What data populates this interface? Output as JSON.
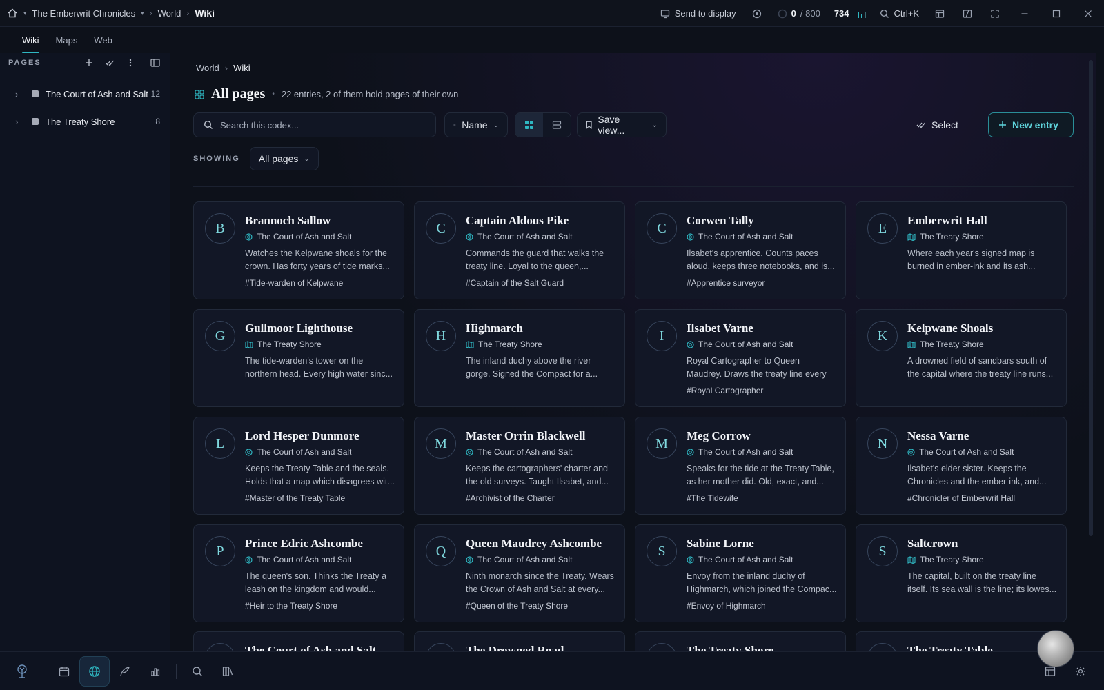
{
  "titlebar": {
    "project": "The Emberwrit Chronicles",
    "crumb_world": "World",
    "crumb_wiki": "Wiki",
    "send_to_display": "Send to display",
    "counter": "0",
    "counter_max": "/ 800",
    "word_count": "734",
    "shortcut": "Ctrl+K"
  },
  "tabs": [
    "Wiki",
    "Maps",
    "Web"
  ],
  "sidebar": {
    "label": "PAGES",
    "items": [
      {
        "name": "The Court of Ash and Salt",
        "count": "12"
      },
      {
        "name": "The Treaty Shore",
        "count": "8"
      }
    ]
  },
  "main": {
    "breadcrumb": [
      "World",
      "Wiki"
    ],
    "title": "All pages",
    "subtitle": "22 entries, 2 of them hold pages of their own",
    "search_placeholder": "Search this codex...",
    "sort_label": "Name",
    "save_view_label": "Save view...",
    "select_label": "Select",
    "new_entry_label": "New entry",
    "showing_label": "SHOWING",
    "showing_value": "All pages"
  },
  "cards": [
    {
      "letter": "B",
      "title": "Brannoch Sallow",
      "category": "The Court of Ash and Salt",
      "kind": "org",
      "desc": "Watches the Kelpwane shoals for the crown. Has forty years of tide marks...",
      "tag": "#Tide-warden of Kelpwane"
    },
    {
      "letter": "C",
      "title": "Captain Aldous Pike",
      "category": "The Court of Ash and Salt",
      "kind": "org",
      "desc": "Commands the guard that walks the treaty line. Loyal to the queen,...",
      "tag": "#Captain of the Salt Guard"
    },
    {
      "letter": "C",
      "title": "Corwen Tally",
      "category": "The Court of Ash and Salt",
      "kind": "org",
      "desc": "Ilsabet's apprentice. Counts paces aloud, keeps three notebooks, and is...",
      "tag": "#Apprentice surveyor"
    },
    {
      "letter": "E",
      "title": "Emberwrit Hall",
      "category": "The Treaty Shore",
      "kind": "map",
      "desc": "Where each year's signed map is burned in ember-ink and its ash...",
      "tag": ""
    },
    {
      "letter": "G",
      "title": "Gullmoor Lighthouse",
      "category": "The Treaty Shore",
      "kind": "map",
      "desc": "The tide-warden's tower on the northern head. Every high water sinc...",
      "tag": ""
    },
    {
      "letter": "H",
      "title": "Highmarch",
      "category": "The Treaty Shore",
      "kind": "map",
      "desc": "The inland duchy above the river gorge. Signed the Compact for a...",
      "tag": ""
    },
    {
      "letter": "I",
      "title": "Ilsabet Varne",
      "category": "The Court of Ash and Salt",
      "kind": "org",
      "desc": "Royal Cartographer to Queen Maudrey. Draws the treaty line every spring an...",
      "tag": "#Royal Cartographer"
    },
    {
      "letter": "K",
      "title": "Kelpwane Shoals",
      "category": "The Treaty Shore",
      "kind": "map",
      "desc": "A drowned field of sandbars south of the capital where the treaty line runs...",
      "tag": ""
    },
    {
      "letter": "L",
      "title": "Lord Hesper Dunmore",
      "category": "The Court of Ash and Salt",
      "kind": "org",
      "desc": "Keeps the Treaty Table and the seals. Holds that a map which disagrees wit...",
      "tag": "#Master of the Treaty Table"
    },
    {
      "letter": "M",
      "title": "Master Orrin Blackwell",
      "category": "The Court of Ash and Salt",
      "kind": "org",
      "desc": "Keeps the cartographers' charter and the old surveys. Taught Ilsabet, and...",
      "tag": "#Archivist of the Charter"
    },
    {
      "letter": "M",
      "title": "Meg Corrow",
      "category": "The Court of Ash and Salt",
      "kind": "org",
      "desc": "Speaks for the tide at the Treaty Table, as her mother did. Old, exact, and...",
      "tag": "#The Tidewife"
    },
    {
      "letter": "N",
      "title": "Nessa Varne",
      "category": "The Court of Ash and Salt",
      "kind": "org",
      "desc": "Ilsabet's elder sister. Keeps the Chronicles and the ember-ink, and...",
      "tag": "#Chronicler of Emberwrit Hall"
    },
    {
      "letter": "P",
      "title": "Prince Edric Ashcombe",
      "category": "The Court of Ash and Salt",
      "kind": "org",
      "desc": "The queen's son. Thinks the Treaty a leash on the kingdom and would...",
      "tag": "#Heir to the Treaty Shore"
    },
    {
      "letter": "Q",
      "title": "Queen Maudrey Ashcombe",
      "category": "The Court of Ash and Salt",
      "kind": "org",
      "desc": "Ninth monarch since the Treaty. Wears the Crown of Ash and Salt at every...",
      "tag": "#Queen of the Treaty Shore"
    },
    {
      "letter": "S",
      "title": "Sabine Lorne",
      "category": "The Court of Ash and Salt",
      "kind": "org",
      "desc": "Envoy from the inland duchy of Highmarch, which joined the Compac...",
      "tag": "#Envoy of Highmarch"
    },
    {
      "letter": "S",
      "title": "Saltcrown",
      "category": "The Treaty Shore",
      "kind": "map",
      "desc": "The capital, built on the treaty line itself. Its sea wall is the line; its lowes...",
      "tag": ""
    }
  ],
  "partial_cards": [
    {
      "title": "The Court of Ash and Salt"
    },
    {
      "title": "The Drowned Road"
    },
    {
      "title": "The Treaty Shore"
    },
    {
      "title": "The Treaty Table"
    }
  ],
  "colors": {
    "accent": "#2fb7c2",
    "background": "#0d111a",
    "card": "#121726"
  }
}
